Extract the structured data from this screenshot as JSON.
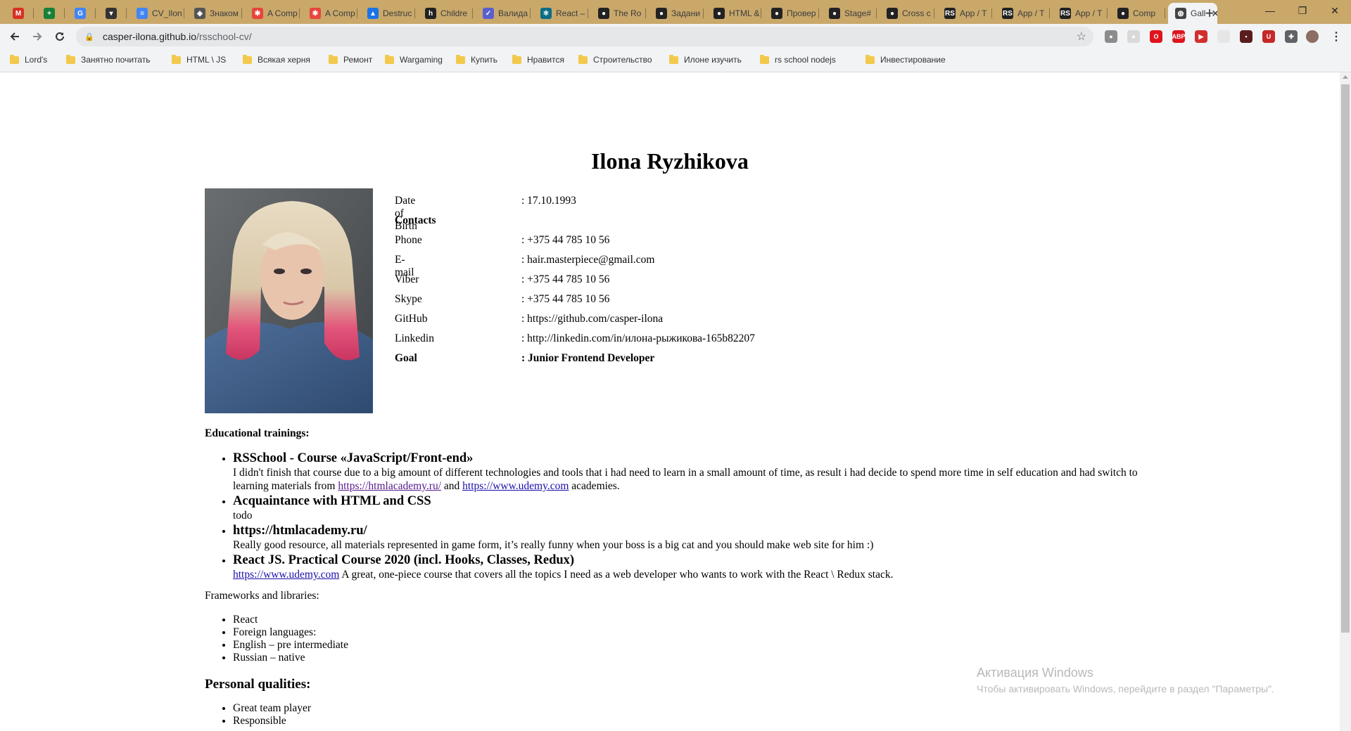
{
  "tabs": [
    {
      "title": "",
      "icon": "gmail-icon",
      "color": "#d93025",
      "glyph": "M"
    },
    {
      "title": "",
      "icon": "sheets-icon",
      "color": "#188038",
      "glyph": "+"
    },
    {
      "title": "",
      "icon": "translate-icon",
      "color": "#4285f4",
      "glyph": "G"
    },
    {
      "title": "",
      "icon": "pocket-icon",
      "color": "#333333",
      "glyph": "▾"
    },
    {
      "title": "CV_Ilon",
      "icon": "docs-icon",
      "color": "#4285f4",
      "glyph": "≡"
    },
    {
      "title": "Знаком",
      "icon": "shield-icon",
      "color": "#555555",
      "glyph": "◆"
    },
    {
      "title": "A Comp",
      "icon": "asterisk-icon",
      "color": "#e8453c",
      "glyph": "✱"
    },
    {
      "title": "A Comp",
      "icon": "asterisk-icon",
      "color": "#e8453c",
      "glyph": "✱"
    },
    {
      "title": "Destruc",
      "icon": "triangle-icon",
      "color": "#1a73e8",
      "glyph": "▲"
    },
    {
      "title": "Childre",
      "icon": "h-icon",
      "color": "#222222",
      "glyph": "h"
    },
    {
      "title": "Валида",
      "icon": "circle-check-icon",
      "color": "#5a5fcf",
      "glyph": "✓"
    },
    {
      "title": "React –",
      "icon": "react-icon",
      "color": "#0b6d86",
      "glyph": "⚛"
    },
    {
      "title": "The Ro",
      "icon": "github-icon",
      "color": "#222222",
      "glyph": "●"
    },
    {
      "title": "Задани",
      "icon": "github-icon",
      "color": "#222222",
      "glyph": "●"
    },
    {
      "title": "HTML &",
      "icon": "github-icon",
      "color": "#222222",
      "glyph": "●"
    },
    {
      "title": "Провер",
      "icon": "github-icon",
      "color": "#222222",
      "glyph": "●"
    },
    {
      "title": "Stage#",
      "icon": "github-icon",
      "color": "#222222",
      "glyph": "●"
    },
    {
      "title": "Cross c",
      "icon": "github-icon",
      "color": "#222222",
      "glyph": "●"
    },
    {
      "title": "App / T",
      "icon": "rs-icon",
      "color": "#222222",
      "glyph": "RS"
    },
    {
      "title": "App / T",
      "icon": "rs-icon",
      "color": "#222222",
      "glyph": "RS"
    },
    {
      "title": "App / T",
      "icon": "rs-icon",
      "color": "#222222",
      "glyph": "RS"
    },
    {
      "title": "Comp",
      "icon": "github-icon",
      "color": "#222222",
      "glyph": "●"
    },
    {
      "title": "Gall",
      "icon": "globe-icon",
      "color": "#444444",
      "glyph": "◍",
      "active": true
    }
  ],
  "address": {
    "host": "casper-ilona.github.io",
    "path": "/rsschool-cv/"
  },
  "extensions": [
    {
      "icon": "extension-gray-icon",
      "color": "#8c8c8c",
      "glyph": "●"
    },
    {
      "icon": "extension-light-icon",
      "color": "#d9d9d9",
      "glyph": "●"
    },
    {
      "icon": "opera-icon",
      "color": "#e0141e",
      "glyph": "O"
    },
    {
      "icon": "adblock-icon",
      "color": "#e0141e",
      "glyph": "ABP"
    },
    {
      "icon": "video-icon",
      "color": "#d32f2f",
      "glyph": "▶"
    },
    {
      "icon": "blank-icon",
      "color": "#e6e6e6",
      "glyph": ""
    },
    {
      "icon": "red-dark-icon",
      "color": "#5a1d1d",
      "glyph": "▪"
    },
    {
      "icon": "ublock-icon",
      "color": "#c62828",
      "glyph": "U"
    },
    {
      "icon": "puzzle-icon",
      "color": "#5f6368",
      "glyph": "✚"
    }
  ],
  "bookmarks": [
    "Lord's",
    "Занятно почитать",
    "HTML \\ JS",
    "Всякая херня",
    "Ремонт",
    "Wargaming",
    "Купить",
    "Нравится",
    "Строительство",
    "Илоне изучить",
    "rs school nodejs",
    "Инвестирование"
  ],
  "cv": {
    "name": "Ilona Ryzhikova",
    "info": [
      {
        "key": "Date of Birth",
        "value": ": 17.10.1993",
        "bold": false
      },
      {
        "key": "Contacts",
        "value": "",
        "bold": true
      },
      {
        "key": "Phone",
        "value": ": +375 44 785 10 56",
        "bold": false
      },
      {
        "key": "E-mail",
        "value": ": hair.masterpiece@gmail.com",
        "bold": false
      },
      {
        "key": "Viber",
        "value": ": +375 44 785 10 56",
        "bold": false
      },
      {
        "key": "Skype",
        "value": ": +375 44 785 10 56",
        "bold": false
      },
      {
        "key": "GitHub",
        "value": ": https://github.com/casper-ilona",
        "bold": false
      },
      {
        "key": "Linkedin",
        "value": ": http://linkedin.com/in/илона-рыжикова-165b82207",
        "bold": false
      },
      {
        "key": "Goal",
        "value": ": Junior Frontend Developer",
        "bold": true
      }
    ],
    "edu_title": "Educational trainings:",
    "courses": [
      {
        "title": "RSSchool - Course «JavaScript/Front-end»",
        "desc_before": "I didn't finish that course due to a big amount of different technologies and tools that i had need to learn in a small amount of time, as result i had decide to spend more time in self education and had switch to learning materials from ",
        "link1": "https://htmlacademy.ru/",
        "desc_mid": " and ",
        "link2": "https://www.udemy.com",
        "desc_after": " academies."
      },
      {
        "title": "Acquaintance with HTML and CSS",
        "desc": "todo"
      },
      {
        "title": "https://htmlacademy.ru/",
        "desc": "Really good resource, all materials represented in game form, it’s really funny when your boss is a big cat and you should make web site for him :)"
      },
      {
        "title": "React JS. Practical Course 2020 (incl. Hooks, Classes, Redux)",
        "link": "https://www.udemy.com",
        "desc_after": " A great, one-piece course that covers all the topics I need as a web developer who wants to work with the React \\ Redux stack."
      }
    ],
    "frameworks_label": "Frameworks and libraries:",
    "frameworks": [
      "React",
      "Foreign languages:",
      "English – pre intermediate",
      "Russian – native"
    ],
    "qualities_title": "Personal qualities:",
    "qualities": [
      "Great team player",
      "Responsible"
    ]
  },
  "watermark": {
    "line1": "Активация Windows",
    "line2": "Чтобы активировать Windows, перейдите в раздел \"Параметры\"."
  }
}
